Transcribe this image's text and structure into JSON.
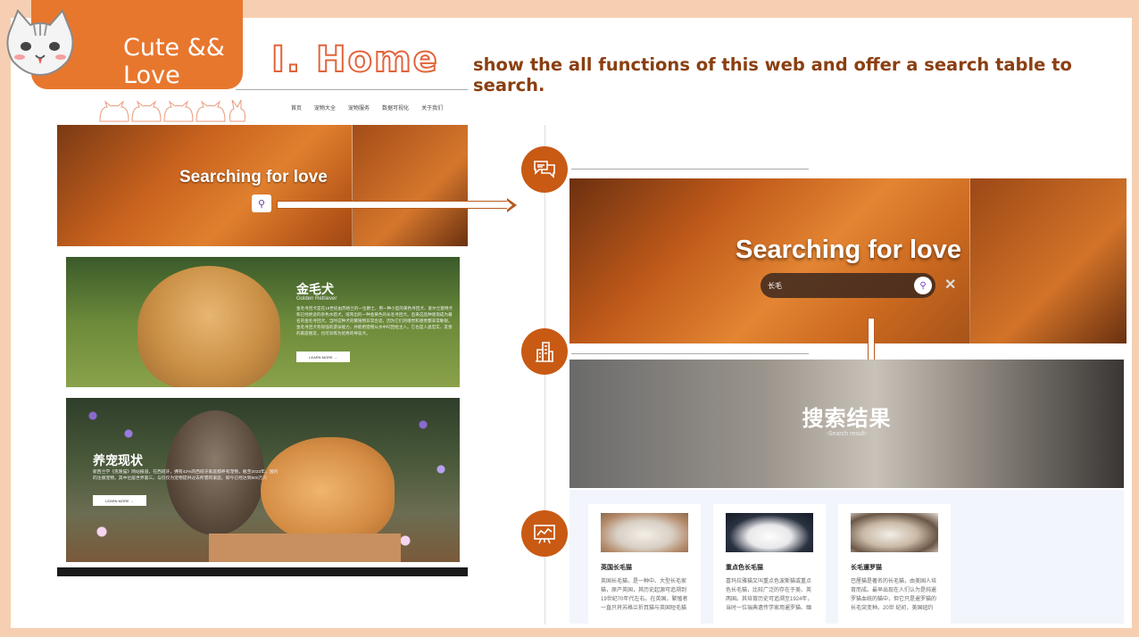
{
  "badge": {
    "text": "Cute && Love"
  },
  "section": {
    "title": "I. Home",
    "subtitle": "show the all functions of this web and offer a search table to search."
  },
  "left_page": {
    "nav": [
      "首页",
      "宠物大全",
      "宠物服务",
      "数据可视化",
      "关于我们"
    ],
    "hero_text": "Searching for love",
    "dog_card": {
      "title": "金毛犬",
      "subtitle": "Golden Retriever",
      "description": "金毛寻回犬是在19世纪由苏格兰的一位爵士，用一种小型的黄色寻回犬、爱尔兰塞特犬和已经绝迹的杂色水猎犬，培育出的一种金黄色的长毛寻回犬。后来这品种逐渐成为著名的金毛寻回犬。当时这种犬的繁殖物非常合适，因为它们的嗅觉和感觉都非常敏锐。金毛寻回犬有很强的游泳能力，并能把猎物从水中叼回给主人。它也是人类忠实、友善的家庭朋友，也可训练为优秀的导盲犬。",
      "button": "LEARN MORE →"
    },
    "cat_card": {
      "title": "养宠现状",
      "description": "新西兰学《克隆猫》网站报道，在西班牙，拥有42%的西班牙家庭都养有宠物，截至2023年，国内的注册宠物，其中位居世界第三。与仅仅为宠物提供过去所需的家庭。如今已经达到900万只",
      "button": "LEARN MORE →"
    }
  },
  "right_page": {
    "hero_text": "Searching for love",
    "search_value": "长毛",
    "close_label": "✕",
    "result_title": "搜索结果",
    "result_subtitle": "-Search result-",
    "results": [
      {
        "name": "英国长毛猫",
        "desc": "英国长毛猫，是一种中、大型长毛家猫，原产英国，其历史起源可追溯到19世纪70年代左右。在英国，繁殖者一直只将苏格兰折耳猫与英国短毛猫"
      },
      {
        "name": "重点色长毛猫",
        "desc": "喜玛拉雅猫又叫重点色波斯猫或重点色长毛猫，比较广泛的存在于美、英两国。其培育历史可追溯至1924年，当时一位瑞典遗传学家用暹罗猫、缅"
      },
      {
        "name": "长毛暹罗猫",
        "desc": "巴厘猫是著名的长毛猫，由美国人培育而成。最早出现在人们认为是纯暹罗猫血统的猫中，但它只是暹罗猫的长毛突变种。20世 纪初，美国纽约"
      }
    ]
  },
  "icons": {
    "step1": "chat-icon",
    "step2": "buildings-icon",
    "step3": "chart-board-icon"
  },
  "colors": {
    "accent": "#e8772e",
    "dark_accent": "#c85a14",
    "background": "#f6cfb2"
  }
}
